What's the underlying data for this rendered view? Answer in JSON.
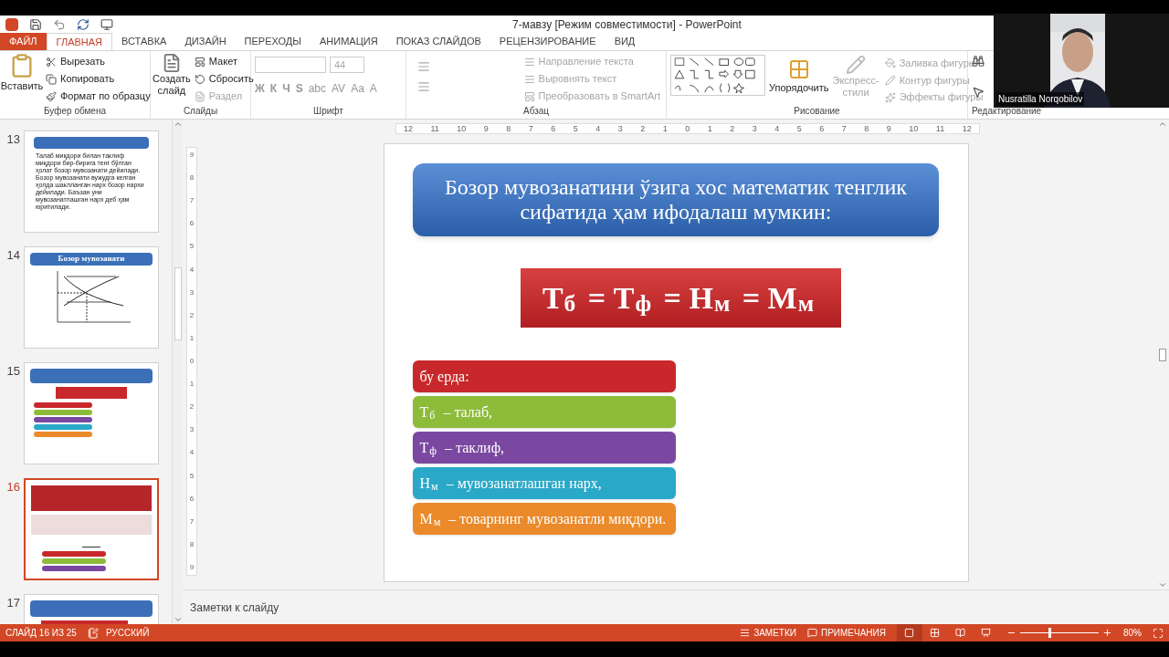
{
  "window": {
    "title": "7-мавзу [Режим совместимости] - PowerPoint"
  },
  "tabs": [
    {
      "label": "ФАЙЛ",
      "kind": "file",
      "selected": false
    },
    {
      "label": "ГЛАВНАЯ",
      "kind": "tab",
      "selected": true
    },
    {
      "label": "ВСТАВКА",
      "kind": "tab",
      "selected": false
    },
    {
      "label": "ДИЗАЙН",
      "kind": "tab",
      "selected": false
    },
    {
      "label": "ПЕРЕХОДЫ",
      "kind": "tab",
      "selected": false
    },
    {
      "label": "АНИМАЦИЯ",
      "kind": "tab",
      "selected": false
    },
    {
      "label": "ПОКАЗ СЛАЙДОВ",
      "kind": "tab",
      "selected": false
    },
    {
      "label": "РЕЦЕНЗИРОВАНИЕ",
      "kind": "tab",
      "selected": false
    },
    {
      "label": "ВИД",
      "kind": "tab",
      "selected": false
    }
  ],
  "ribbon": {
    "clipboard": {
      "name": "Буфер обмена",
      "paste": "Вставить",
      "commands": [
        "Вырезать",
        "Копировать",
        "Формат по образцу"
      ]
    },
    "slides": {
      "name": "Слайды",
      "new_slide": [
        "Создать",
        "слайд"
      ],
      "commands": [
        {
          "label": "Макет",
          "disabled": false
        },
        {
          "label": "Сбросить",
          "disabled": false
        },
        {
          "label": "Раздел",
          "disabled": true
        }
      ]
    },
    "font": {
      "name": "Шрифт",
      "size": "44",
      "buttons": [
        "Ж",
        "К",
        "Ч",
        "S",
        "abc",
        "AV",
        "Aa",
        "A"
      ]
    },
    "paragraph": {
      "name": "Абзац",
      "commands": [
        "Направление текста",
        "Выровнять текст",
        "Преобразовать в SmartArt"
      ]
    },
    "drawing": {
      "name": "Рисование",
      "arrange": "Упорядочить",
      "styles": [
        "Экспресс-",
        "стили"
      ],
      "commands": [
        "Заливка фигуры",
        "Контур фигуры",
        "Эффекты фигуры"
      ]
    },
    "editing": {
      "name": "Редактирование"
    }
  },
  "video": {
    "name": "Nusratilla Norqobilov"
  },
  "thumbnails": [
    {
      "number": "13",
      "kind": "text",
      "selected": false,
      "body": "Талаб миқдори билан таклиф миқдори бир-бирига тенг бўлган ҳолат бозор мувозанати дейилади. Бозор мувозанати вужудга келган ҳолда шаклланган нарх бозор нархи дейилади. Баъзан уни мувозанатлашган нарх деб ҳам юритилади."
    },
    {
      "number": "14",
      "kind": "chart",
      "selected": false,
      "title": "Бозор мувозанати"
    },
    {
      "number": "15",
      "kind": "formula",
      "selected": false
    },
    {
      "number": "16",
      "kind": "mixed",
      "selected": true
    },
    {
      "number": "17",
      "kind": "title",
      "selected": false
    }
  ],
  "rulers": {
    "horizontal": [
      "12",
      "11",
      "10",
      "9",
      "8",
      "7",
      "6",
      "5",
      "4",
      "3",
      "2",
      "1",
      "0",
      "1",
      "2",
      "3",
      "4",
      "5",
      "6",
      "7",
      "8",
      "9",
      "10",
      "11",
      "12"
    ],
    "vertical": [
      "9",
      "8",
      "7",
      "6",
      "5",
      "4",
      "3",
      "2",
      "1",
      "0",
      "1",
      "2",
      "3",
      "4",
      "5",
      "6",
      "7",
      "8",
      "9"
    ]
  },
  "slide": {
    "title": "Бозор мувозанатини ўзига хос математик тенглик сифатида ҳам ифодалаш мумкин:",
    "formula": "Т$_{б}$ = Т$_{ф}$ = Н$_{м}$ = М$_{м}$",
    "items": [
      {
        "text": "бу ерда:",
        "color": "#c8282c"
      },
      {
        "text": "Т$_{б}$ – талаб,",
        "color": "#8dbb3a"
      },
      {
        "text": "Т$_{ф}$ – таклиф,",
        "color": "#7a48a0"
      },
      {
        "text": "Н$_{м}$ – мувозанатлашган нарх,",
        "color": "#2aa8c8"
      },
      {
        "text": "М$_{м}$ – товарнинг мувозанатли миқдори.",
        "color": "#ea8a2a"
      }
    ]
  },
  "notes": {
    "placeholder": "Заметки к слайду"
  },
  "status_bar": {
    "slide": "СЛАЙД 16 ИЗ 25",
    "language": "РУССКИЙ",
    "notes": "ЗАМЕТКИ",
    "comments": "ПРИМЕЧАНИЯ",
    "views": [
      {
        "kind": "normal",
        "selected": true
      },
      {
        "kind": "sorter",
        "selected": false
      },
      {
        "kind": "reading",
        "selected": false
      },
      {
        "kind": "show",
        "selected": false
      }
    ],
    "zoom": {
      "level": 0.38
    },
    "zoom_text": "80%"
  }
}
